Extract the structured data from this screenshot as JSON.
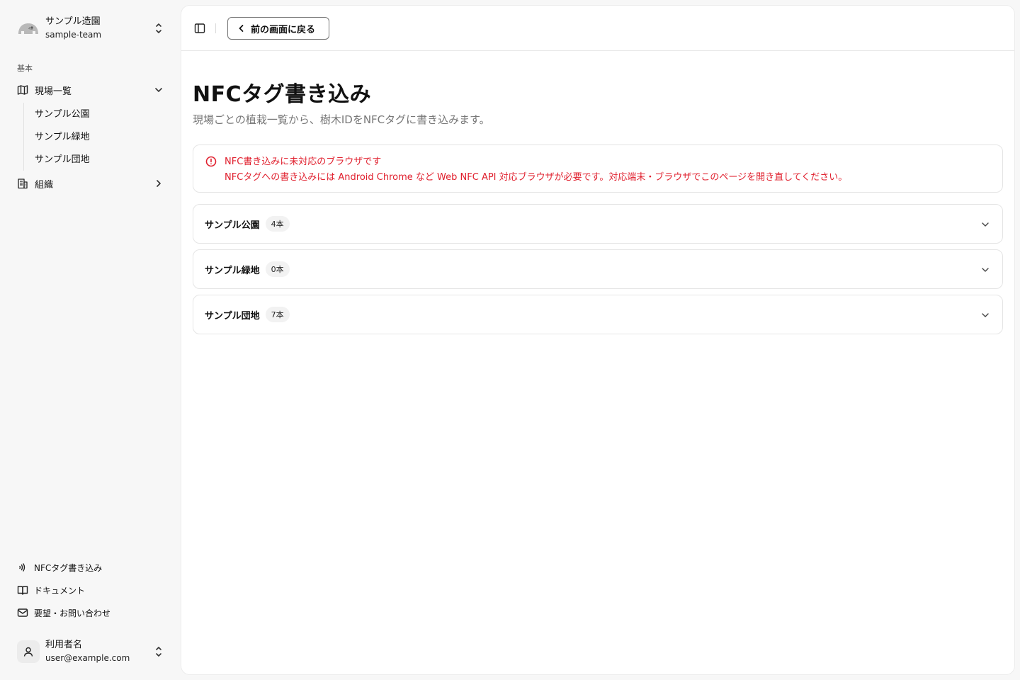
{
  "team": {
    "name": "サンプル造園",
    "id": "sample-team"
  },
  "nav": {
    "group_label": "基本",
    "sites_label": "現場一覧",
    "sites": [
      {
        "label": "サンプル公園"
      },
      {
        "label": "サンプル緑地"
      },
      {
        "label": "サンプル団地"
      }
    ],
    "org_label": "組織"
  },
  "footer_nav": {
    "nfc": "NFCタグ書き込み",
    "docs": "ドキュメント",
    "contact": "要望・お問い合わせ"
  },
  "user": {
    "name": "利用者名",
    "email": "user@example.com"
  },
  "topbar": {
    "back_label": "前の画面に戻る"
  },
  "page": {
    "title": "NFCタグ書き込み",
    "description": "現場ごとの植栽一覧から、樹木IDをNFCタグに書き込みます。"
  },
  "alert": {
    "title": "NFC書き込みに未対応のブラウザです",
    "body": "NFCタグへの書き込みには Android Chrome など Web NFC API 対応ブラウザが必要です。対応端末・ブラウザでこのページを開き直してください。",
    "color": "#e0202e"
  },
  "sites_accordion": [
    {
      "name": "サンプル公園",
      "count": "4本"
    },
    {
      "name": "サンプル緑地",
      "count": "0本"
    },
    {
      "name": "サンプル団地",
      "count": "7本"
    }
  ],
  "icons": {
    "team_logo": "elephant-logo-icon",
    "switcher": "chevrons-up-down-icon",
    "sites": "map-icon",
    "org": "building-icon",
    "nfc": "nfc-icon",
    "docs": "book-open-icon",
    "contact": "mail-icon",
    "user": "user-icon",
    "sidebar_toggle": "panel-left-icon",
    "back": "chevron-left-icon",
    "alert": "alert-circle-icon",
    "expand": "chevron-down-icon"
  }
}
